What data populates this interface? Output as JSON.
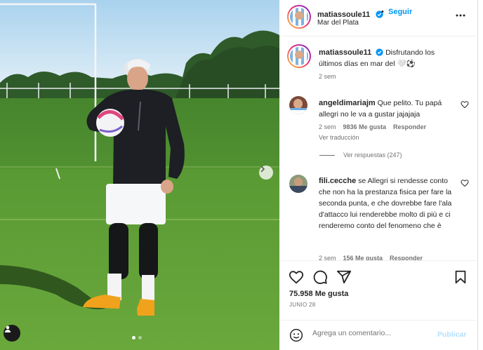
{
  "post": {
    "author": "matiassoule11",
    "location": "Mar del Plata",
    "follow_label": "Seguir",
    "follow_separator": "•",
    "caption": "Disfrutando los últimos días en mar del 🤍⚽",
    "caption_time": "2 sem"
  },
  "comments": [
    {
      "user": "angeldimariajm",
      "text": "Que pelito. Tu papá allegri no le va a gustar jajajaja",
      "time": "2 sem",
      "likes": "9836 Me gusta",
      "reply": "Responder",
      "translate": "Ver traducción",
      "view_replies": "Ver respuestas (247)"
    },
    {
      "user": "fili.cecche",
      "text": "se Allegri si rendesse conto che non ha la prestanza fisica per fare la seconda punta, e che dovrebbe fare l'ala d'attacco lui renderebbe molto di più e ci renderemo conto del fenomeno che è",
      "time": "2 sem",
      "likes": "156 Me gusta",
      "reply": "Responder"
    }
  ],
  "stats": {
    "likes": "75.958 Me gusta",
    "date": "JUNIO 28"
  },
  "composer": {
    "placeholder": "Agrega un comentario...",
    "publish_label": "Publicar"
  },
  "colors": {
    "accent": "#0095f6",
    "publish_disabled": "#b2dffc",
    "grass": "#4f8a2f",
    "sky": "#cfe4f3"
  },
  "icons": [
    "user-tag-icon",
    "chevron-right-icon",
    "verified-icon",
    "more-icon",
    "heart-icon",
    "comment-icon",
    "share-icon",
    "bookmark-icon",
    "emoji-icon"
  ]
}
